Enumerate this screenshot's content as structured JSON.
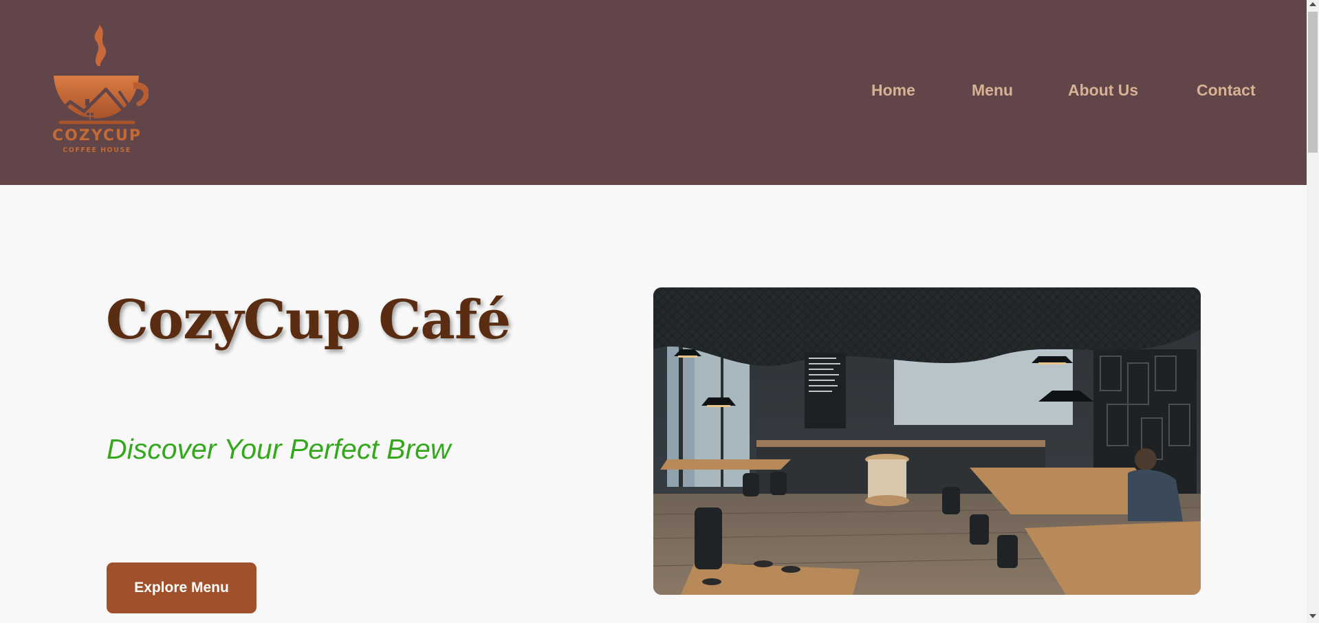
{
  "brand": {
    "logo_name": "COZYCUP",
    "logo_subtitle": "COFFEE HOUSE",
    "logo_color": "#c46a34"
  },
  "header": {
    "background": "#614548",
    "nav": [
      {
        "label": "Home"
      },
      {
        "label": "Menu"
      },
      {
        "label": "About Us"
      },
      {
        "label": "Contact"
      }
    ]
  },
  "hero": {
    "title": "CozyCup Café",
    "subtitle": "Discover Your Perfect Brew",
    "cta_label": "Explore Menu",
    "title_color": "#5a2d12",
    "subtitle_color": "#34a81c",
    "cta_color": "#a0512b",
    "image_icon": "cafe-interior-photo"
  }
}
